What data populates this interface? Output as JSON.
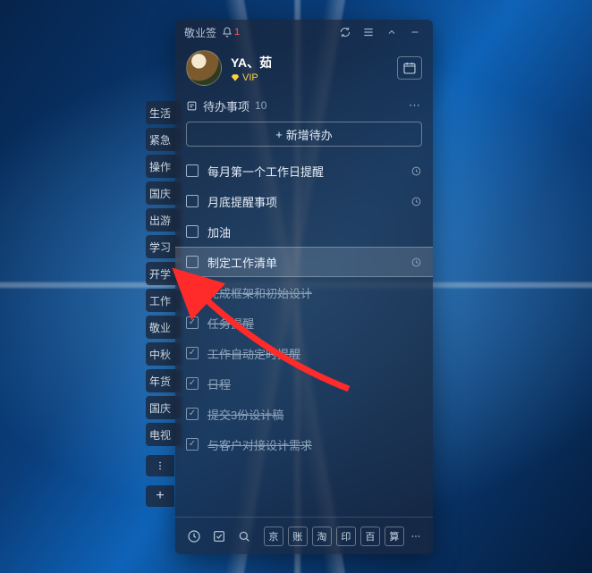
{
  "titlebar": {
    "app_name": "敬业签",
    "notification_count": "1"
  },
  "profile": {
    "username": "YA、茹",
    "vip_label": "VIP"
  },
  "section": {
    "title": "待办事项",
    "count": "10",
    "add_label": "新增待办"
  },
  "side_tabs": [
    "生活",
    "紧急",
    "操作",
    "国庆",
    "出游",
    "学习",
    "开学",
    "工作",
    "敬业",
    "中秋",
    "年货",
    "国庆",
    "电视"
  ],
  "todos": [
    {
      "label": "每月第一个工作日提醒",
      "done": false,
      "clock": true
    },
    {
      "label": "月底提醒事项",
      "done": false,
      "clock": true
    },
    {
      "label": "加油",
      "done": false,
      "clock": false
    },
    {
      "label": "制定工作清单",
      "done": false,
      "clock": true,
      "active": true
    },
    {
      "label": "完成框架和初始设计",
      "done": true,
      "clock": false
    },
    {
      "label": "任务提醒",
      "done": true,
      "clock": false
    },
    {
      "label": "工作自动定时提醒",
      "done": true,
      "clock": false
    },
    {
      "label": "日程",
      "done": true,
      "clock": false
    },
    {
      "label": "提交3份设计稿",
      "done": true,
      "clock": false
    },
    {
      "label": "与客户对接设计需求",
      "done": true,
      "clock": false
    }
  ],
  "bottom_quick": [
    "京",
    "账",
    "淘",
    "印",
    "百",
    "算"
  ]
}
